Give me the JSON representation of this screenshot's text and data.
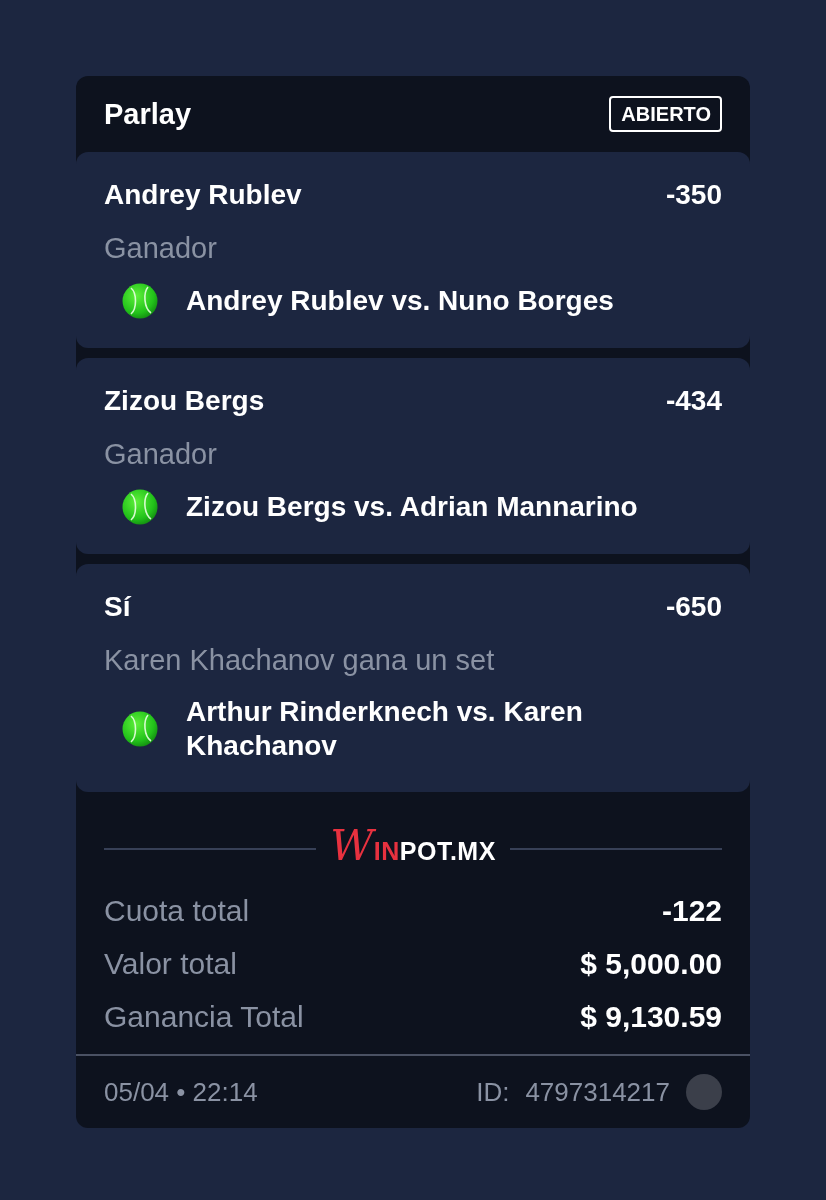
{
  "ticket": {
    "title": "Parlay",
    "status": "ABIERTO"
  },
  "legs": [
    {
      "selection": "Andrey Rublev",
      "odds": "-350",
      "market": "Ganador",
      "match": "Andrey Rublev vs. Nuno Borges"
    },
    {
      "selection": "Zizou Bergs",
      "odds": "-434",
      "market": "Ganador",
      "match": "Zizou Bergs vs. Adrian Mannarino"
    },
    {
      "selection": "Sí",
      "odds": "-650",
      "market": "Karen Khachanov gana un set",
      "match": "Arthur Rinderknech vs. Karen Khachanov"
    }
  ],
  "brand": {
    "highlight": "WIN",
    "rest": "POT.MX"
  },
  "totals": [
    {
      "label": "Cuota total",
      "value": "-122"
    },
    {
      "label": "Valor total",
      "value": "$ 5,000.00"
    },
    {
      "label": "Ganancia Total",
      "value": "$ 9,130.59"
    }
  ],
  "footer": {
    "date": "05/04 • 22:14",
    "id_label": "ID:",
    "id": "4797314217"
  }
}
